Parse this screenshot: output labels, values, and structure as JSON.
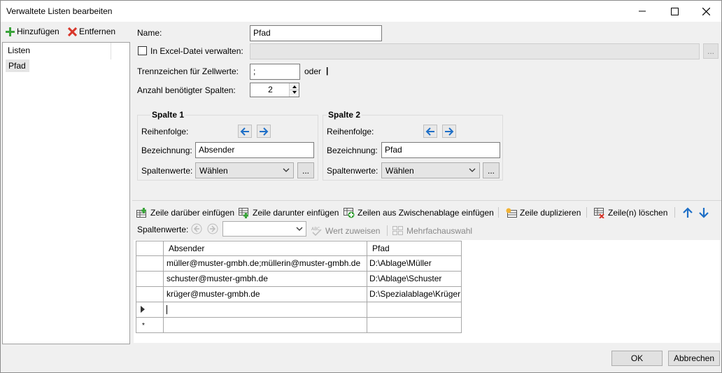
{
  "window": {
    "title": "Verwaltete Listen bearbeiten"
  },
  "left": {
    "add_label": "Hinzufügen",
    "remove_label": "Entfernen",
    "list_header": "Listen",
    "items": [
      {
        "label": "Pfad"
      }
    ]
  },
  "form": {
    "name_label": "Name:",
    "name_value": "Pfad",
    "excel_label": "In Excel-Datei verwalten:",
    "excel_checked": false,
    "excel_value": "",
    "browse_label": "...",
    "separator_label": "Trennzeichen für Zellwerte:",
    "separator_value": ";",
    "or_label": "oder",
    "or_value": "|",
    "columns_label": "Anzahl benötigter Spalten:",
    "columns_value": "2"
  },
  "col1": {
    "title": "Spalte 1",
    "order_label": "Reihenfolge:",
    "name_label": "Bezeichnung:",
    "name_value": "Absender",
    "values_label": "Spaltenwerte:",
    "values_select": "Wählen",
    "more_label": "..."
  },
  "col2": {
    "title": "Spalte 2",
    "order_label": "Reihenfolge:",
    "name_label": "Bezeichnung:",
    "name_value": "Pfad",
    "values_label": "Spaltenwerte:",
    "values_select": "Wählen",
    "more_label": "..."
  },
  "toolbar": {
    "insert_above": "Zeile darüber einfügen",
    "insert_below": "Zeile darunter einfügen",
    "paste_rows": "Zeilen aus Zwischenablage einfügen",
    "duplicate": "Zeile duplizieren",
    "delete_rows": "Zeile(n) löschen"
  },
  "toolbar2": {
    "values_label": "Spaltenwerte:",
    "values_select": "",
    "assign": "Wert zuweisen",
    "multi": "Mehrfachauswahl"
  },
  "table": {
    "columns": [
      "Absender",
      "Pfad"
    ],
    "rows": [
      [
        "müller@muster-gmbh.de;müllerin@muster-gmbh.de",
        "D:\\Ablage\\Müller"
      ],
      [
        "schuster@muster-gmbh.de",
        "D:\\Ablage\\Schuster"
      ],
      [
        "krüger@muster-gmbh.de",
        "D:\\Spezialablage\\Krüger"
      ],
      [
        "",
        ""
      ],
      [
        "",
        ""
      ]
    ],
    "new_row_marker": "*"
  },
  "footer": {
    "ok": "OK",
    "cancel": "Abbrechen"
  },
  "colors": {
    "accent_blue": "#1e6fc7",
    "add_green": "#3aa33a",
    "remove_red": "#d8362a"
  }
}
